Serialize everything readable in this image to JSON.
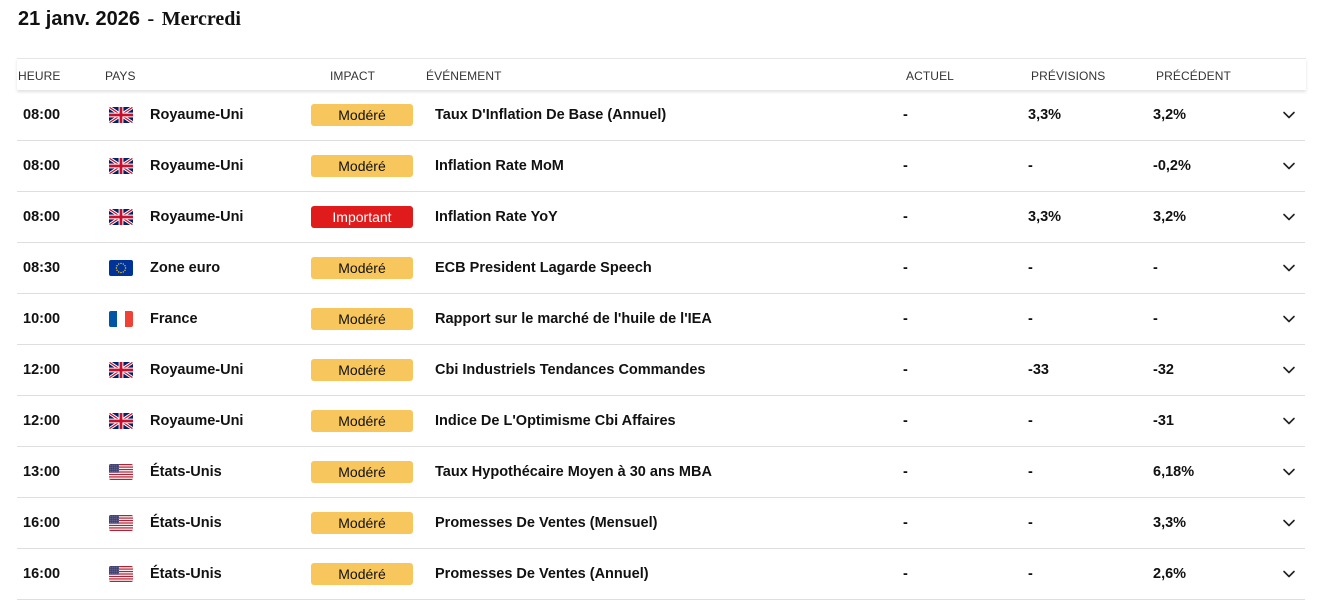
{
  "header": {
    "date": "21 janv. 2026",
    "separator": "-",
    "weekday": "Mercredi"
  },
  "columns": {
    "time": "HEURE",
    "country": "PAYS",
    "impact": "IMPACT",
    "event": "ÉVÉNEMENT",
    "actual": "ACTUEL",
    "forecast": "PRÉVISIONS",
    "previous": "PRÉCÉDENT"
  },
  "impact_colors": {
    "Modéré": "#f7c65c",
    "Important": "#e01b1b"
  },
  "rows": [
    {
      "time": "08:00",
      "flag": "uk-flag-icon",
      "country": "Royaume-Uni",
      "impact": "Modéré",
      "impact_level": "moderate",
      "event": "Taux D'Inflation De Base (Annuel)",
      "actual": "-",
      "forecast": "3,3%",
      "previous": "3,2%"
    },
    {
      "time": "08:00",
      "flag": "uk-flag-icon",
      "country": "Royaume-Uni",
      "impact": "Modéré",
      "impact_level": "moderate",
      "event": "Inflation Rate MoM",
      "actual": "-",
      "forecast": "-",
      "previous": "-0,2%"
    },
    {
      "time": "08:00",
      "flag": "uk-flag-icon",
      "country": "Royaume-Uni",
      "impact": "Important",
      "impact_level": "important",
      "event": "Inflation Rate YoY",
      "actual": "-",
      "forecast": "3,3%",
      "previous": "3,2%"
    },
    {
      "time": "08:30",
      "flag": "eu-flag-icon",
      "country": "Zone euro",
      "impact": "Modéré",
      "impact_level": "moderate",
      "event": "ECB President Lagarde Speech",
      "actual": "-",
      "forecast": "-",
      "previous": "-"
    },
    {
      "time": "10:00",
      "flag": "fr-flag-icon",
      "country": "France",
      "impact": "Modéré",
      "impact_level": "moderate",
      "event": "Rapport sur le marché de l'huile de l'IEA",
      "actual": "-",
      "forecast": "-",
      "previous": "-"
    },
    {
      "time": "12:00",
      "flag": "uk-flag-icon",
      "country": "Royaume-Uni",
      "impact": "Modéré",
      "impact_level": "moderate",
      "event": "Cbi Industriels Tendances Commandes",
      "actual": "-",
      "forecast": "-33",
      "previous": "-32"
    },
    {
      "time": "12:00",
      "flag": "uk-flag-icon",
      "country": "Royaume-Uni",
      "impact": "Modéré",
      "impact_level": "moderate",
      "event": "Indice De L'Optimisme Cbi Affaires",
      "actual": "-",
      "forecast": "-",
      "previous": "-31"
    },
    {
      "time": "13:00",
      "flag": "us-flag-icon",
      "country": "États-Unis",
      "impact": "Modéré",
      "impact_level": "moderate",
      "event": "Taux Hypothécaire Moyen à 30 ans MBA",
      "actual": "-",
      "forecast": "-",
      "previous": "6,18%"
    },
    {
      "time": "16:00",
      "flag": "us-flag-icon",
      "country": "États-Unis",
      "impact": "Modéré",
      "impact_level": "moderate",
      "event": "Promesses De Ventes (Mensuel)",
      "actual": "-",
      "forecast": "-",
      "previous": "3,3%"
    },
    {
      "time": "16:00",
      "flag": "us-flag-icon",
      "country": "États-Unis",
      "impact": "Modéré",
      "impact_level": "moderate",
      "event": "Promesses De Ventes (Annuel)",
      "actual": "-",
      "forecast": "-",
      "previous": "2,6%"
    }
  ]
}
